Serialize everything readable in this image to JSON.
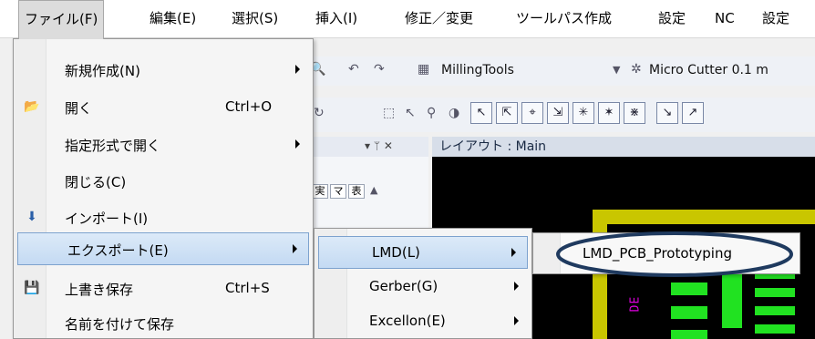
{
  "menubar": {
    "items": [
      "ファイル(F)",
      "編集(E)",
      "選択(S)",
      "挿入(I)",
      "修正／変更",
      "ツールパス作成",
      "設定",
      "NC",
      "設定"
    ]
  },
  "toolbar": {
    "tool_library": "MillingTools",
    "tool_name": "Micro Cutter 0.1 m"
  },
  "panel": {
    "pin_icons": "▾ ᛘ ✕",
    "tabs": [
      "実",
      "マ",
      "表"
    ]
  },
  "layout_tab": "レイアウト : Main",
  "canvas_mark": "DE",
  "file_menu": {
    "items": [
      {
        "label": "新規作成(N)",
        "shortcut": "",
        "has_submenu": true,
        "icon": ""
      },
      {
        "label": "開く",
        "shortcut": "Ctrl+O",
        "has_submenu": false,
        "icon": "open-folder-icon"
      },
      {
        "label": "指定形式で開く",
        "shortcut": "",
        "has_submenu": true,
        "icon": ""
      },
      {
        "label": "閉じる(C)",
        "shortcut": "",
        "has_submenu": false,
        "icon": ""
      },
      {
        "label": "インポート(I)",
        "shortcut": "",
        "has_submenu": false,
        "icon": "import-icon"
      },
      {
        "label": "エクスポート(E)",
        "shortcut": "",
        "has_submenu": true,
        "icon": "",
        "highlighted": true
      },
      {
        "label": "上書き保存",
        "shortcut": "Ctrl+S",
        "has_submenu": false,
        "icon": "save-icon"
      },
      {
        "label": "名前を付けて保存",
        "shortcut": "",
        "has_submenu": false,
        "icon": ""
      }
    ]
  },
  "export_menu": {
    "items": [
      {
        "label": "LMD(L)",
        "highlighted": true
      },
      {
        "label": "Gerber(G)",
        "highlighted": false
      },
      {
        "label": "Excellon(E)",
        "highlighted": false
      }
    ]
  },
  "lmd_menu": {
    "items": [
      "LMD_PCB_Prototyping"
    ]
  },
  "colors": {
    "highlight_ellipse": "#1f3a5f",
    "trace_yellow": "#c9c600",
    "pad_green": "#21e221",
    "label_magenta": "#e000e0"
  }
}
